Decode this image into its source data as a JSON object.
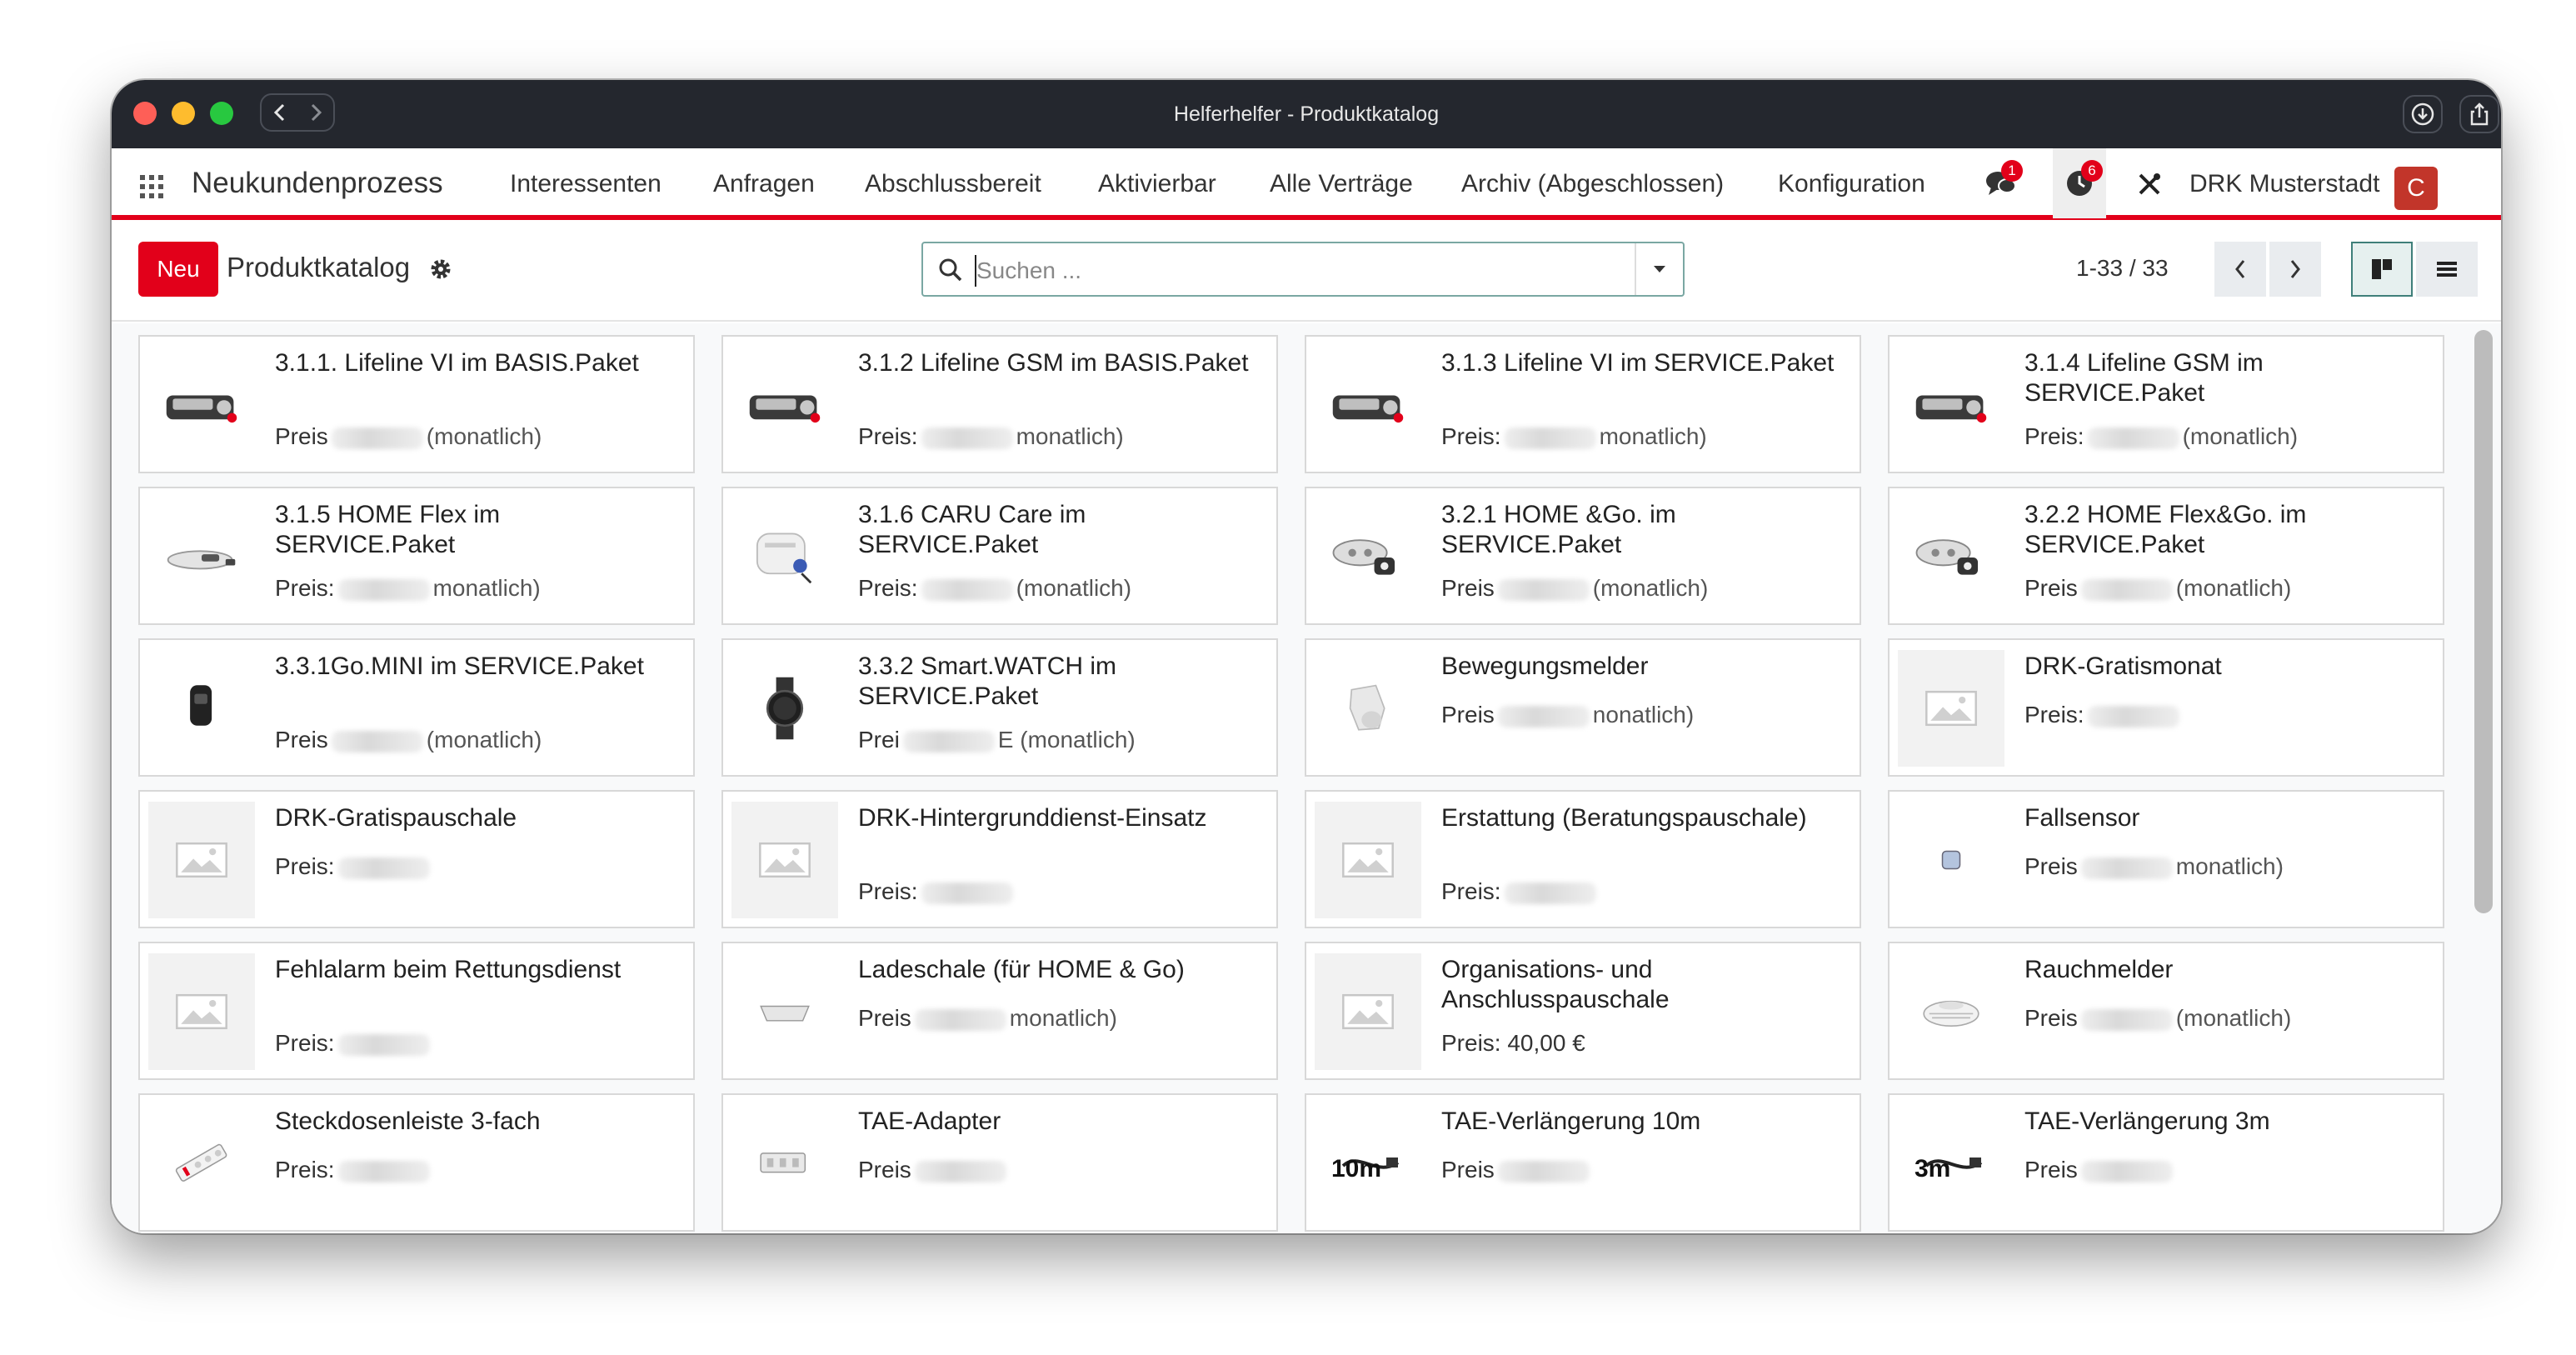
{
  "window": {
    "title": "Helferhelfer - Produktkatalog"
  },
  "navbar": {
    "brand": "Neukundenprozess",
    "menu": [
      "Interessenten",
      "Anfragen",
      "Abschlussbereit",
      "Aktivierbar",
      "Alle Verträge",
      "Archiv (Abgeschlossen)",
      "Konfiguration"
    ],
    "messages_badge": "1",
    "activity_badge": "6",
    "company": "DRK Musterstadt",
    "avatar_letter": "C"
  },
  "control_panel": {
    "new_label": "Neu",
    "title": "Produktkatalog",
    "search_placeholder": "Suchen ...",
    "pager": "1-33 / 33"
  },
  "colors": {
    "brand_red": "#e2001a",
    "avatar": "#c2352a"
  },
  "products": [
    {
      "title": "3.1.1. Lifeline VI im BASIS.Paket",
      "price_label": "Preis",
      "suffix": "(monatlich)",
      "image": "lifeline-device"
    },
    {
      "title": "3.1.2 Lifeline GSM im BASIS.Paket",
      "price_label": "Preis:",
      "suffix": "monatlich)",
      "image": "lifeline-device"
    },
    {
      "title": "3.1.3 Lifeline VI im SERVICE.Paket",
      "price_label": "Preis:",
      "suffix": "monatlich)",
      "image": "lifeline-device"
    },
    {
      "title": "3.1.4 Lifeline GSM im SERVICE.Paket",
      "price_label": "Preis:",
      "suffix": "(monatlich)",
      "image": "lifeline-device"
    },
    {
      "title": "3.1.5 HOME Flex im SERVICE.Paket",
      "price_label": "Preis:",
      "suffix": "monatlich)",
      "image": "home-flex"
    },
    {
      "title": "3.1.6 CARU Care im SERVICE.Paket",
      "price_label": "Preis:",
      "suffix": "(monatlich)",
      "image": "caru-care"
    },
    {
      "title": "3.2.1 HOME &Go. im SERVICE.Paket",
      "price_label": "Preis",
      "suffix": "(monatlich)",
      "image": "home-go"
    },
    {
      "title": "3.2.2 HOME Flex&Go. im SERVICE.Paket",
      "price_label": "Preis",
      "suffix": "(monatlich)",
      "image": "home-go"
    },
    {
      "title": "3.3.1Go.MINI im SERVICE.Paket",
      "price_label": "Preis",
      "suffix": "(monatlich)",
      "image": "go-mini"
    },
    {
      "title": "3.3.2 Smart.WATCH im SERVICE.Paket",
      "price_label": "Prei",
      "suffix": "E (monatlich)",
      "image": "smartwatch"
    },
    {
      "title": "Bewegungsmelder",
      "price_label": "Preis",
      "suffix": "nonatlich)",
      "image": "motion-sensor"
    },
    {
      "title": "DRK-Gratismonat",
      "price_label": "Preis:",
      "suffix": "",
      "image": "placeholder"
    },
    {
      "title": "DRK-Gratispauschale",
      "price_label": "Preis:",
      "suffix": "",
      "image": "placeholder"
    },
    {
      "title": "DRK-Hintergrunddienst-Einsatz",
      "price_label": "Preis:",
      "suffix": "",
      "image": "placeholder"
    },
    {
      "title": "Erstattung (Beratungspauschale)",
      "price_label": "Preis:",
      "suffix": "",
      "image": "placeholder"
    },
    {
      "title": "Fallsensor",
      "price_label": "Preis",
      "suffix": "monatlich)",
      "image": "fall-sensor"
    },
    {
      "title": "Fehlalarm beim Rettungsdienst",
      "price_label": "Preis:",
      "suffix": "",
      "image": "placeholder"
    },
    {
      "title": "Ladeschale (für HOME & Go)",
      "price_label": "Preis",
      "suffix": "monatlich)",
      "image": "charging-cradle"
    },
    {
      "title": "Organisations- und Anschlusspauschale",
      "price_label": "Preis: 40,00 €",
      "suffix": "",
      "image": "placeholder"
    },
    {
      "title": "Rauchmelder",
      "price_label": "Preis",
      "suffix": "(monatlich)",
      "image": "smoke-detector"
    },
    {
      "title": "Steckdosenleiste 3-fach",
      "price_label": "Preis:",
      "suffix": "",
      "image": "power-strip"
    },
    {
      "title": "TAE-Adapter",
      "price_label": "Preis",
      "suffix": "",
      "image": "tae-adapter"
    },
    {
      "title": "TAE-Verlängerung 10m",
      "price_label": "Preis",
      "suffix": "",
      "image": "tae-cable",
      "thumb_text": "10m"
    },
    {
      "title": "TAE-Verlängerung 3m",
      "price_label": "Preis",
      "suffix": "",
      "image": "tae-cable",
      "thumb_text": "3m"
    }
  ]
}
